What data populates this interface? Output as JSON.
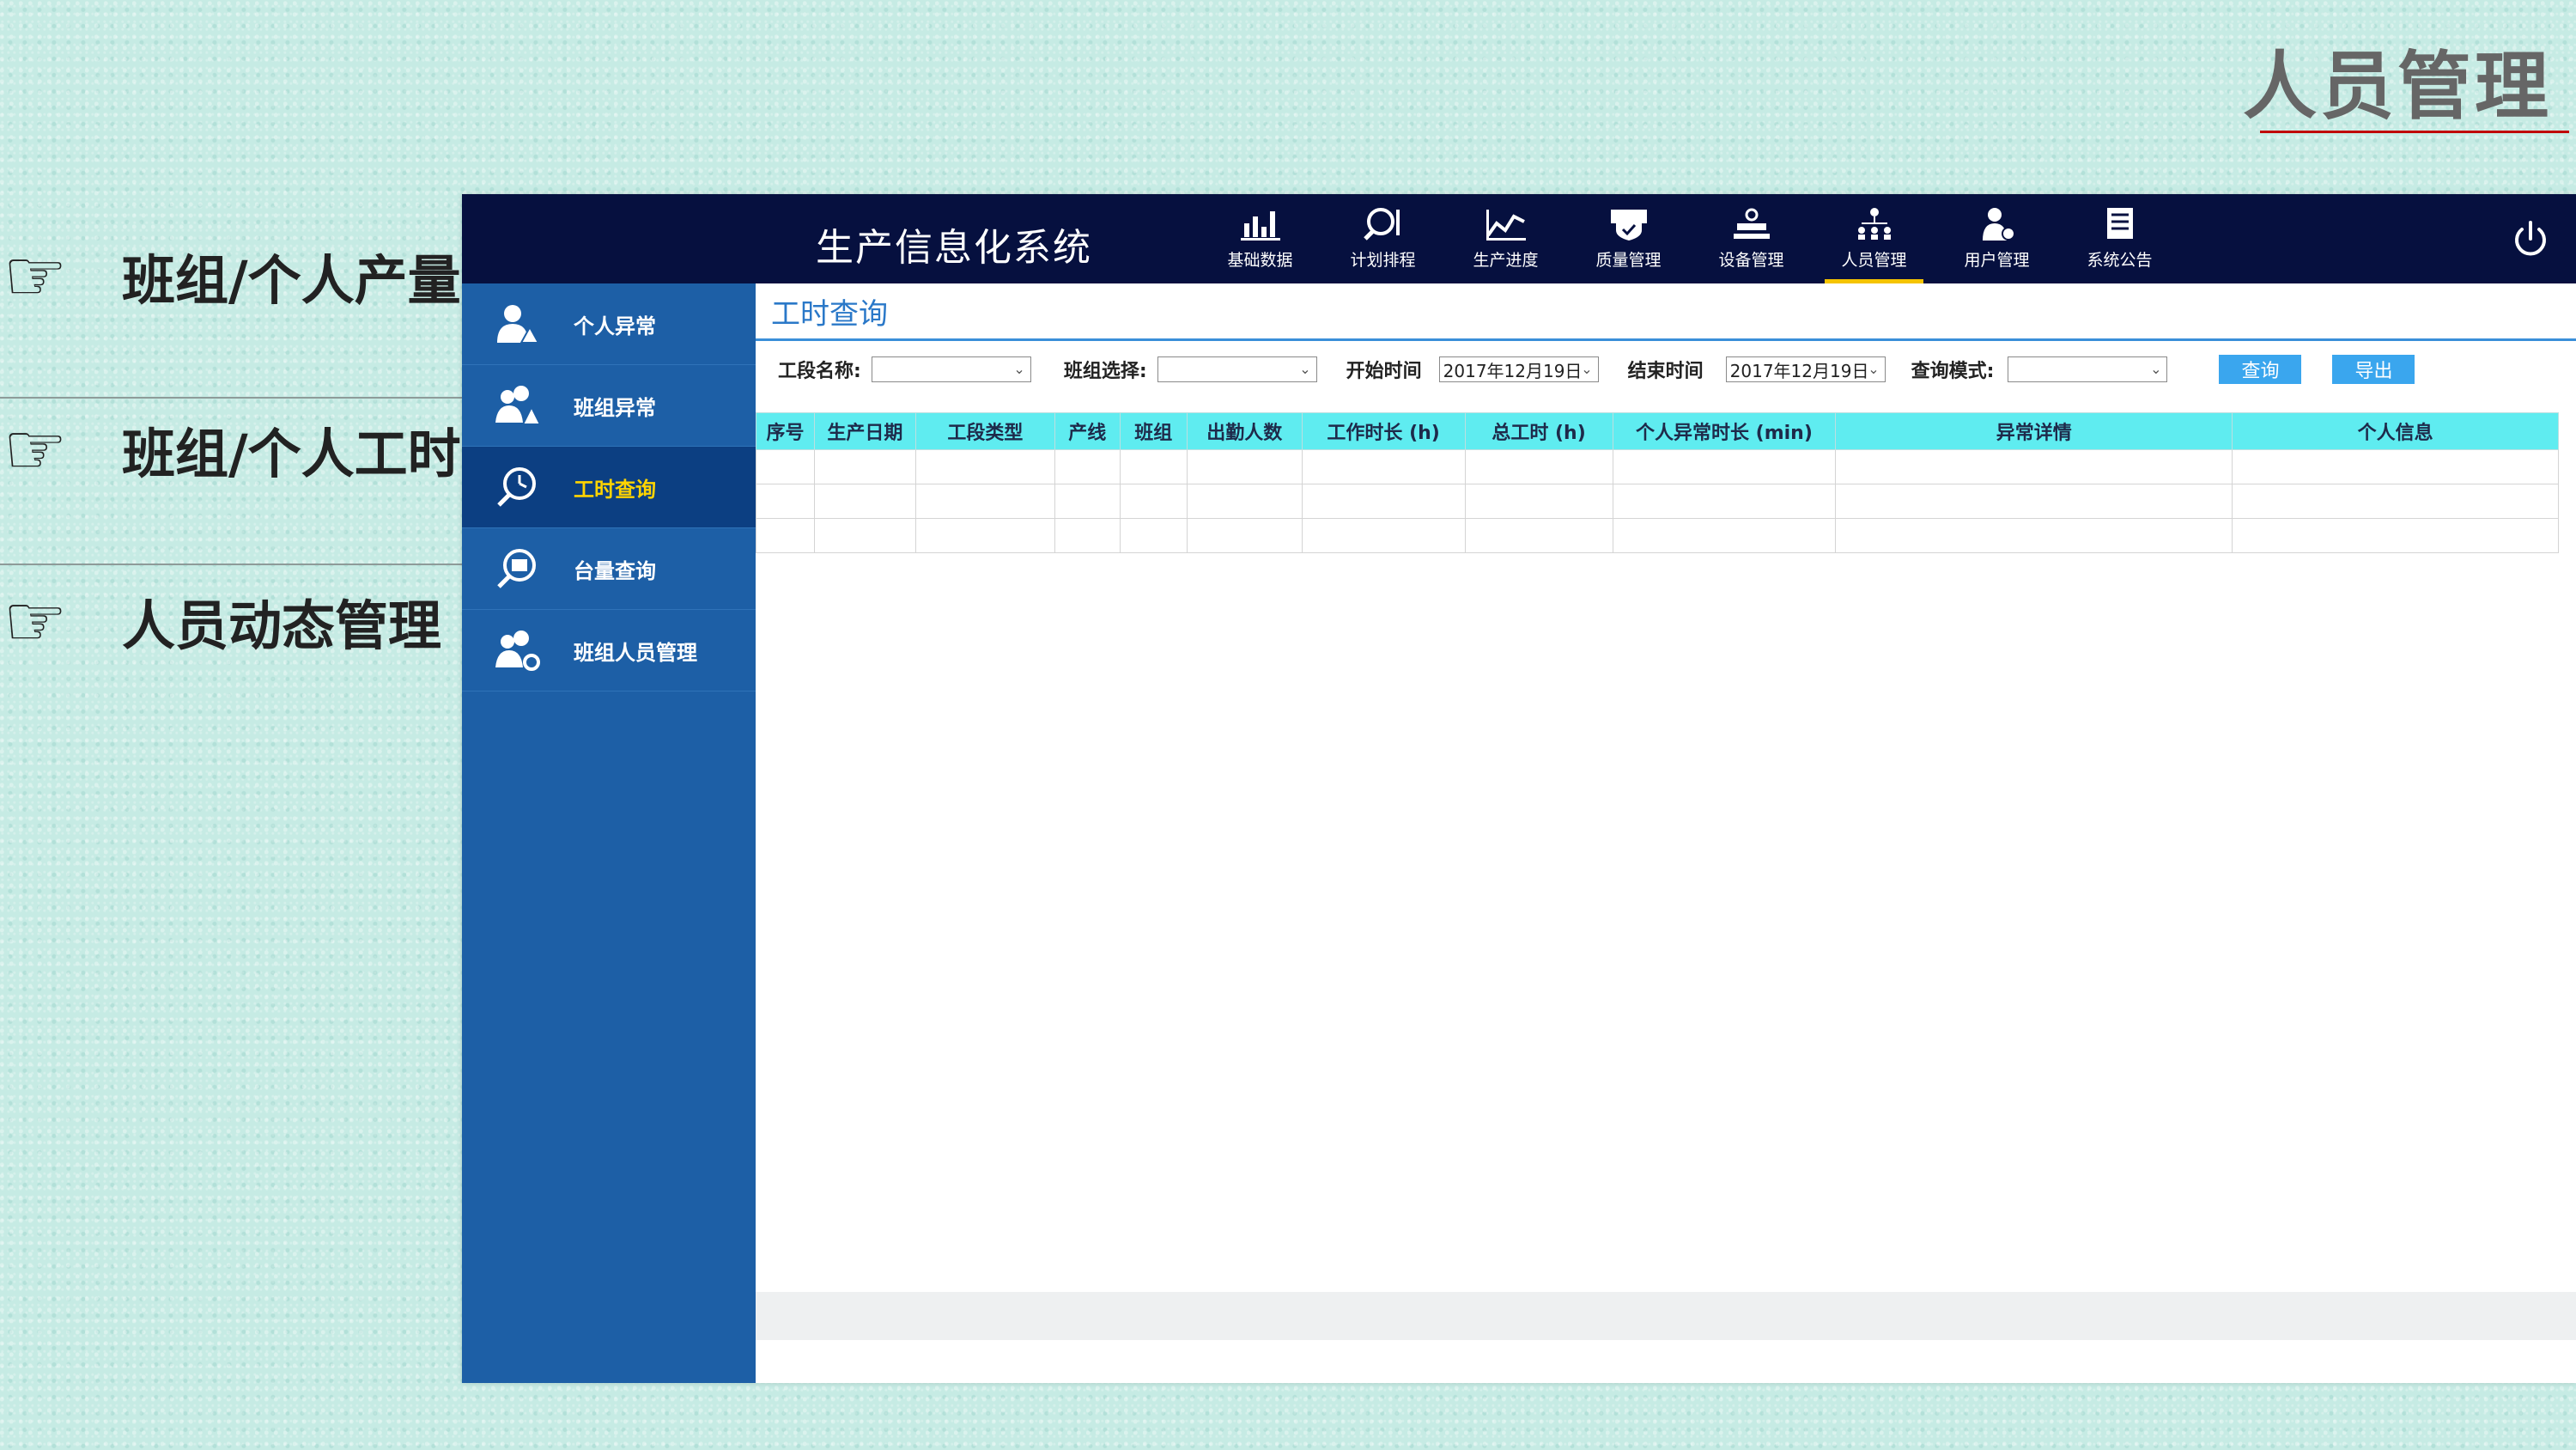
{
  "slide": {
    "title": "人员管理",
    "bullets": [
      {
        "text": "班组/个人产量",
        "icon": "pointing-hand-icon"
      },
      {
        "text": "班组/个人工时",
        "icon": "pointing-hand-icon"
      },
      {
        "text": "人员动态管理",
        "icon": "pointing-hand-icon"
      }
    ]
  },
  "app": {
    "title": "生产信息化系统",
    "nav": [
      {
        "label": "基础数据",
        "icon": "bar-chart-icon"
      },
      {
        "label": "计划排程",
        "icon": "plan-search-icon"
      },
      {
        "label": "生产进度",
        "icon": "line-chart-icon"
      },
      {
        "label": "质量管理",
        "icon": "quality-shield-icon"
      },
      {
        "label": "设备管理",
        "icon": "equipment-icon"
      },
      {
        "label": "人员管理",
        "icon": "org-chart-icon",
        "active": true
      },
      {
        "label": "用户管理",
        "icon": "user-icon"
      },
      {
        "label": "系统公告",
        "icon": "notice-icon"
      }
    ],
    "sidebar": [
      {
        "label": "个人异常",
        "icon": "user-warning-icon"
      },
      {
        "label": "班组异常",
        "icon": "group-warning-icon"
      },
      {
        "label": "工时查询",
        "icon": "clock-search-icon",
        "active": true
      },
      {
        "label": "台量查询",
        "icon": "count-search-icon"
      },
      {
        "label": "班组人员管理",
        "icon": "group-settings-icon"
      }
    ],
    "page_title": "工时查询",
    "filters": {
      "section_label": "工段名称:",
      "section_value": "",
      "team_label": "班组选择:",
      "team_value": "",
      "start_label": "开始时间",
      "start_value": "2017年12月19日",
      "end_label": "结束时间",
      "end_value": "2017年12月19日",
      "mode_label": "查询模式:",
      "mode_value": "",
      "query_button": "查询",
      "export_button": "导出"
    },
    "table": {
      "columns": [
        "序号",
        "生产日期",
        "工段类型",
        "产线",
        "班组",
        "出勤人数",
        "工作时长 (h)",
        "总工时 (h)",
        "个人异常时长 (min)",
        "异常详情",
        "个人信息"
      ]
    }
  }
}
